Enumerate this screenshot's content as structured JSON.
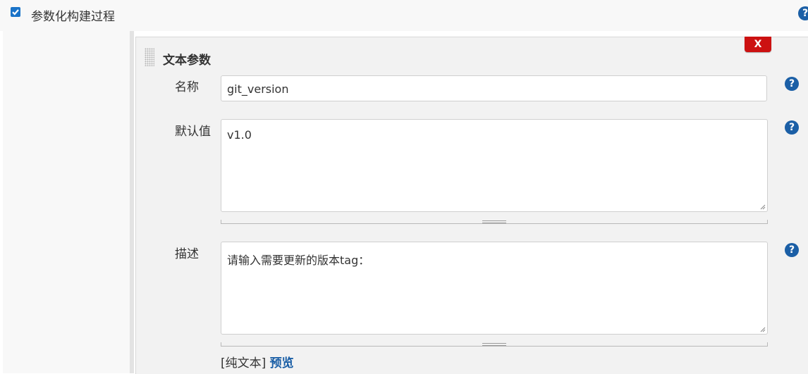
{
  "header": {
    "checkbox_label": "参数化构建过程",
    "checked": true
  },
  "section": {
    "title": "文本参数",
    "delete_label": "X"
  },
  "fields": {
    "name": {
      "label": "名称",
      "value": "git_version"
    },
    "default": {
      "label": "默认值",
      "value": "v1.0"
    },
    "description": {
      "label": "描述",
      "value": "请输入需要更新的版本tag："
    }
  },
  "preview": {
    "plain_text": "[纯文本]",
    "preview_link": "预览"
  },
  "help_icon": "?",
  "colors": {
    "help": "#1b5fa6",
    "delete": "#cc1111",
    "checkbox": "#1a73c8"
  }
}
